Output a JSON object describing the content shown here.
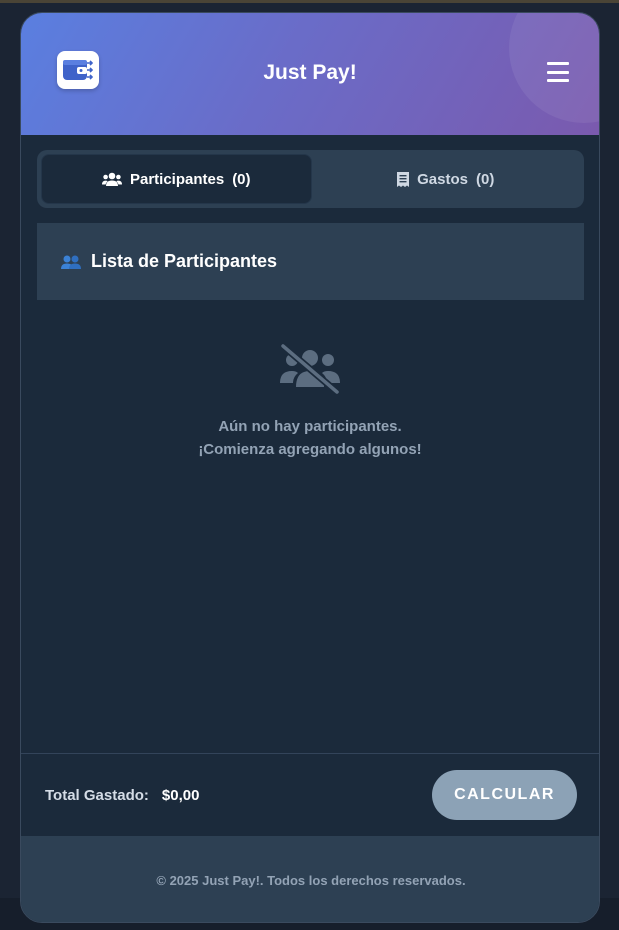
{
  "header": {
    "title": "Just Pay!",
    "logo_icon": "wallet-icon",
    "menu_icon": "hamburger-menu-icon"
  },
  "tabs": [
    {
      "label": "Participantes",
      "count": "(0)",
      "icon": "users-icon",
      "active": true
    },
    {
      "label": "Gastos",
      "count": "(0)",
      "icon": "receipt-icon",
      "active": false
    }
  ],
  "section": {
    "icon": "people-emoji-icon",
    "title": "Lista de Participantes"
  },
  "empty_state": {
    "icon": "users-slash-icon",
    "line1": "Aún no hay participantes.",
    "line2": "¡Comienza agregando algunos!"
  },
  "summary": {
    "total_label": "Total Gastado:",
    "total_value": "$0,00",
    "calculate_label": "CALCULAR"
  },
  "footer": {
    "copyright": "© 2025 Just Pay!. Todos los derechos reservados."
  },
  "colors": {
    "header_gradient_start": "#5a7fe0",
    "header_gradient_end": "#7a5aae",
    "background": "#1b2a3b",
    "panel": "#2d4053",
    "button": "#8ca2b6"
  }
}
